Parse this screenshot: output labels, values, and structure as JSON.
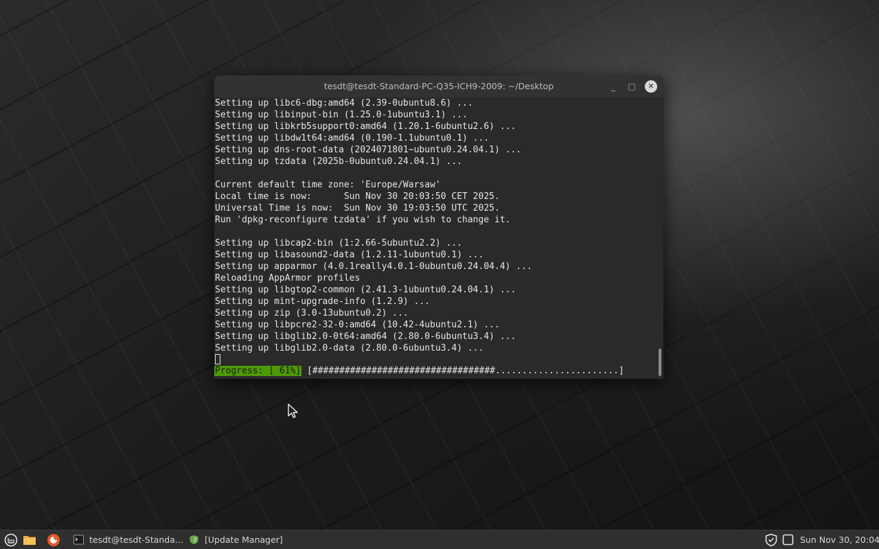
{
  "window": {
    "title": "tesdt@tesdt-Standard-PC-Q35-ICH9-2009: ~/Desktop",
    "minimize_glyph": "_",
    "maximize_glyph": "□",
    "close_glyph": "✕"
  },
  "terminal": {
    "lines": [
      "Setting up libc6-dbg:amd64 (2.39-0ubuntu8.6) ...",
      "Setting up libinput-bin (1.25.0-1ubuntu3.1) ...",
      "Setting up libkrb5support0:amd64 (1.20.1-6ubuntu2.6) ...",
      "Setting up libdw1t64:amd64 (0.190-1.1ubuntu0.1) ...",
      "Setting up dns-root-data (2024071801~ubuntu0.24.04.1) ...",
      "Setting up tzdata (2025b-0ubuntu0.24.04.1) ...",
      "",
      "Current default time zone: 'Europe/Warsaw'",
      "Local time is now:      Sun Nov 30 20:03:50 CET 2025.",
      "Universal Time is now:  Sun Nov 30 19:03:50 UTC 2025.",
      "Run 'dpkg-reconfigure tzdata' if you wish to change it.",
      "",
      "Setting up libcap2-bin (1:2.66-5ubuntu2.2) ...",
      "Setting up libasound2-data (1.2.11-1ubuntu0.1) ...",
      "Setting up apparmor (4.0.1really4.0.1-0ubuntu0.24.04.4) ...",
      "Reloading AppArmor profiles",
      "Setting up libgtop2-common (2.41.3-1ubuntu0.24.04.1) ...",
      "Setting up mint-upgrade-info (1.2.9) ...",
      "Setting up zip (3.0-13ubuntu0.2) ...",
      "Setting up libpcre2-32-0:amd64 (10.42-4ubuntu2.1) ...",
      "Setting up libglib2.0-0t64:amd64 (2.80.0-6ubuntu3.4) ...",
      "Setting up libglib2.0-data (2.80.0-6ubuntu3.4) ..."
    ],
    "progress": {
      "label": "Progress: [ 61%]",
      "bar": " [##################################.......................]",
      "percent": 61
    }
  },
  "taskbar": {
    "icons": [
      "mint-menu-icon",
      "files-icon",
      "firefox-icon"
    ],
    "tasks": [
      {
        "label": "tesdt@tesdt-Standa...",
        "icon": "terminal-icon"
      },
      {
        "label": "[Update Manager]",
        "icon": "update-manager-icon"
      }
    ],
    "tray": [
      "shield-icon",
      "notifications-icon"
    ],
    "clock": "Sun Nov 30, 20:04"
  },
  "colors": {
    "progress_bg": "#4e9a06",
    "terminal_bg": "#2a2a2a",
    "taskbar_bg": "#2f2f2f"
  }
}
